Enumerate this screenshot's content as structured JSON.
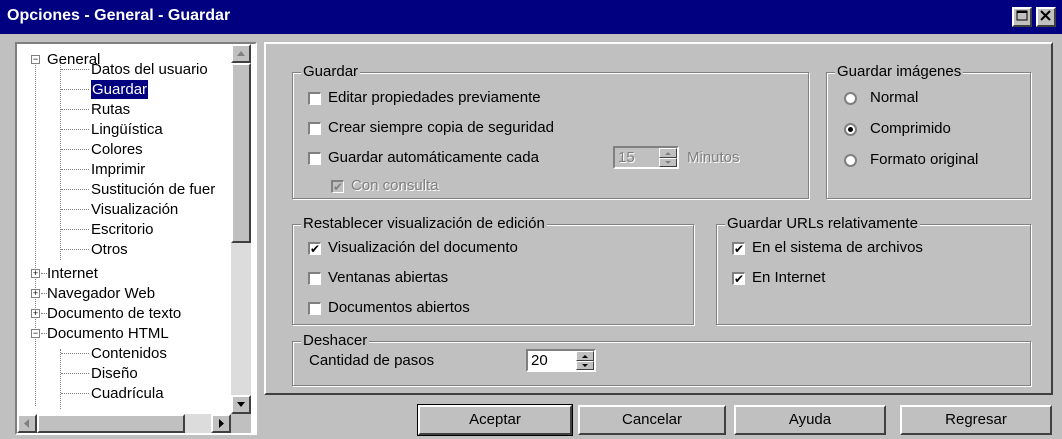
{
  "window": {
    "title": "Opciones - General - Guardar"
  },
  "tree": {
    "items": [
      {
        "label": "General",
        "expander": "⊟"
      },
      {
        "label": "Datos del usuario"
      },
      {
        "label": "Guardar"
      },
      {
        "label": "Rutas"
      },
      {
        "label": "Lingüística"
      },
      {
        "label": "Colores"
      },
      {
        "label": "Imprimir"
      },
      {
        "label": "Sustitución de fuer"
      },
      {
        "label": "Visualización"
      },
      {
        "label": "Escritorio"
      },
      {
        "label": "Otros"
      },
      {
        "label": "Internet",
        "expander": "⊞"
      },
      {
        "label": "Navegador Web",
        "expander": "⊞"
      },
      {
        "label": "Documento de texto",
        "expander": "⊞"
      },
      {
        "label": "Documento HTML",
        "expander": "⊟"
      },
      {
        "label": "Contenidos"
      },
      {
        "label": "Diseño"
      },
      {
        "label": "Cuadrícula"
      }
    ]
  },
  "guardar": {
    "legend": "Guardar",
    "editar": {
      "label": "Editar propiedades previamente",
      "checked": false
    },
    "copia": {
      "label": "Crear siempre copia de seguridad",
      "checked": false
    },
    "auto": {
      "label": "Guardar automáticamente cada",
      "checked": false
    },
    "minutes_value": "15",
    "minutes_label": "Minutos",
    "consulta": {
      "label": "Con consulta",
      "checked": true,
      "disabled": true
    }
  },
  "guardar_imagenes": {
    "legend": "Guardar imágenes",
    "options": [
      {
        "label": "Normal",
        "checked": false
      },
      {
        "label": "Comprimido",
        "checked": true
      },
      {
        "label": "Formato original",
        "checked": false
      }
    ]
  },
  "restablecer": {
    "legend": "Restablecer visualización de edición",
    "items": [
      {
        "label": "Visualización del documento",
        "checked": true
      },
      {
        "label": "Ventanas abiertas",
        "checked": false
      },
      {
        "label": "Documentos abiertos",
        "checked": false
      }
    ]
  },
  "urls": {
    "legend": "Guardar URLs relativamente",
    "items": [
      {
        "label": "En el sistema de archivos",
        "checked": true
      },
      {
        "label": "En Internet",
        "checked": true
      }
    ]
  },
  "deshacer": {
    "legend": "Deshacer",
    "label": "Cantidad de pasos",
    "value": "20"
  },
  "buttons": {
    "aceptar": "Aceptar",
    "cancelar": "Cancelar",
    "ayuda": "Ayuda",
    "regresar": "Regresar"
  },
  "colors": {
    "titlebar": "#000080",
    "face": "#c0c0c0",
    "selection": "#000080"
  }
}
